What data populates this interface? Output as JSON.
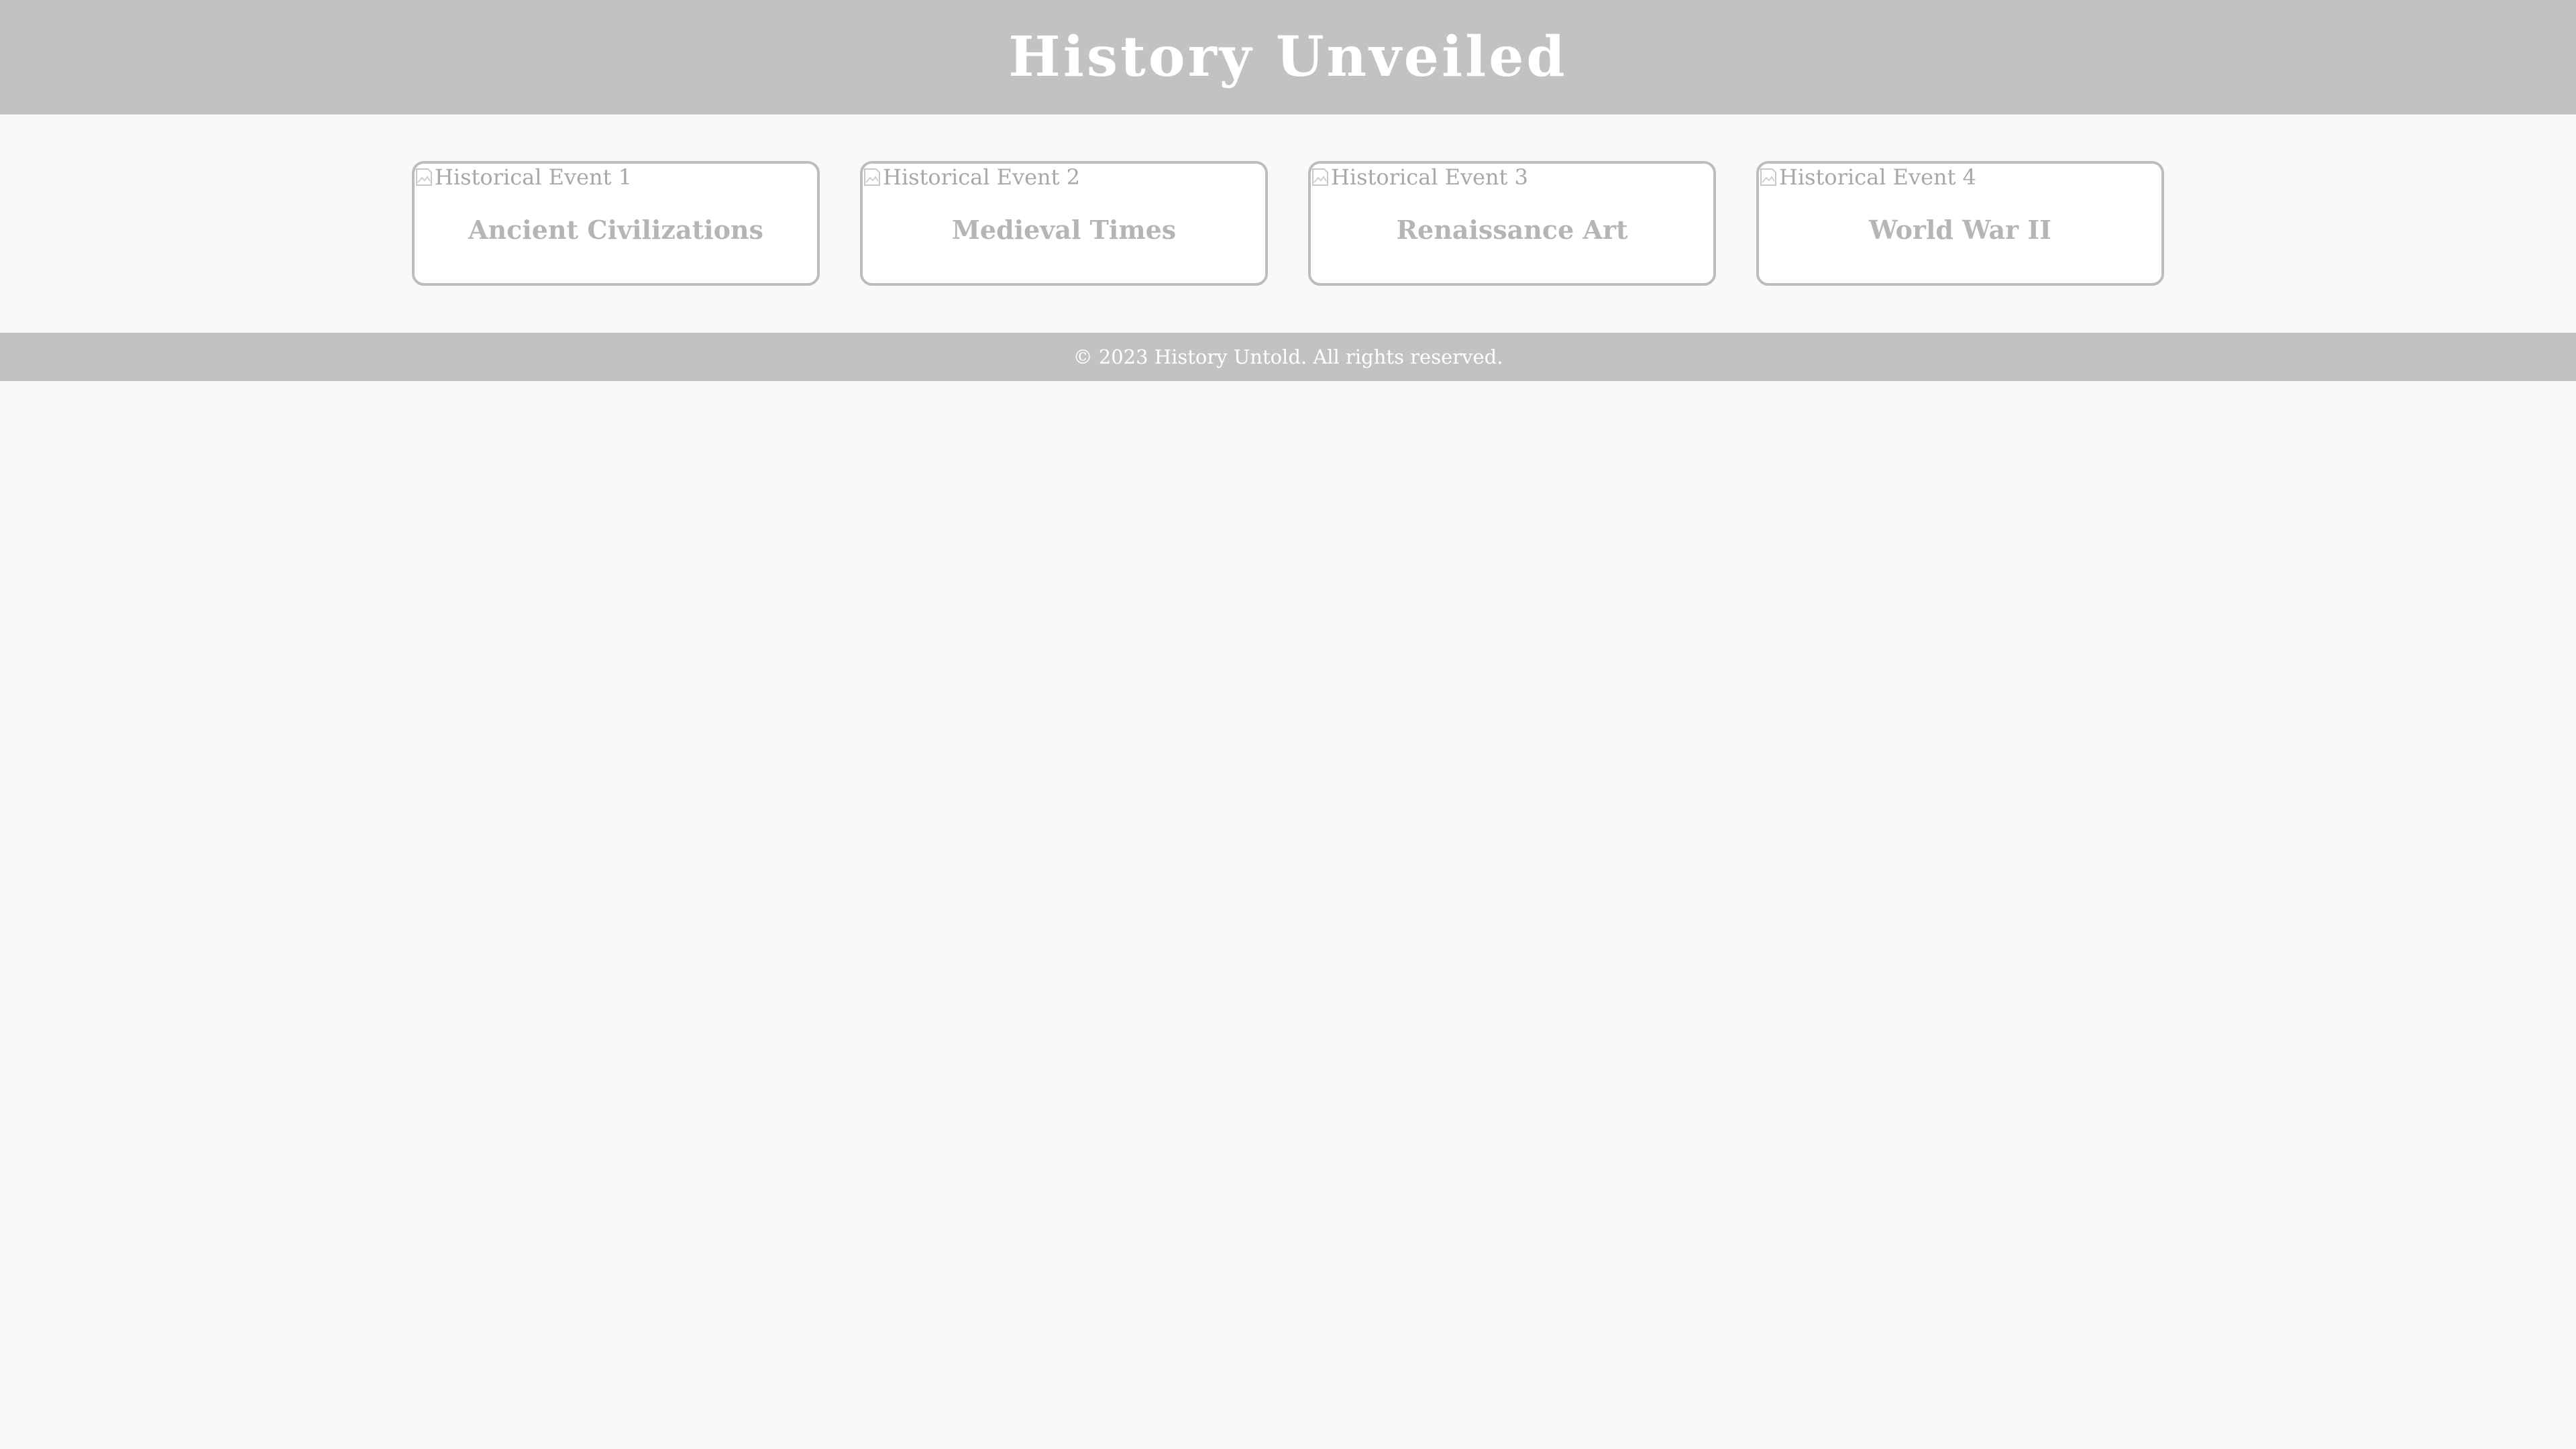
{
  "header": {
    "title": "History Unveiled"
  },
  "cards": [
    {
      "image_alt": "Historical Event 1",
      "title": "Ancient Civilizations"
    },
    {
      "image_alt": "Historical Event 2",
      "title": "Medieval Times"
    },
    {
      "image_alt": "Historical Event 3",
      "title": "Renaissance Art"
    },
    {
      "image_alt": "Historical Event 4",
      "title": "World War II"
    }
  ],
  "footer": {
    "text": "© 2023 History Untold. All rights reserved."
  },
  "colors": {
    "header_bg": "#c2c2c2",
    "page_bg": "#f9f9f9",
    "card_border": "#bdbdbd",
    "card_title": "#b5b5b5"
  },
  "icons": {
    "card_image": "broken-image-icon"
  }
}
